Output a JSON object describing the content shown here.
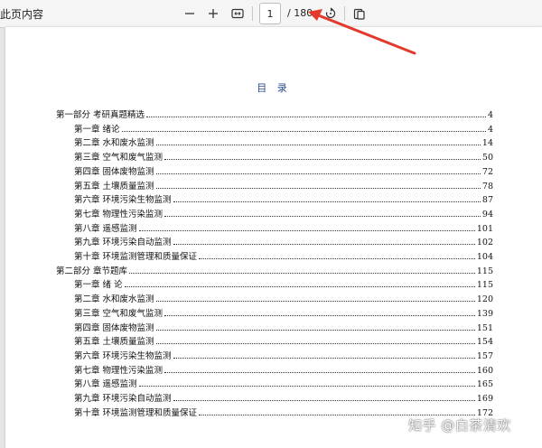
{
  "toolbar": {
    "title": "此页内容",
    "zoom_out_icon": "minus-icon",
    "zoom_in_icon": "plus-icon",
    "fit_icon": "fit-width-icon",
    "current_page": "1",
    "total_pages": "/ 180",
    "rotate_icon": "rotate-icon",
    "pages_icon": "page-view-icon"
  },
  "document": {
    "toc_title": "目 录",
    "sections": [
      {
        "label": "第一部分 考研真题精选",
        "page": "4"
      },
      {
        "label": "第一章 绪论",
        "page": "4"
      },
      {
        "label": "第二章 水和废水监测",
        "page": "14"
      },
      {
        "label": "第三章 空气和废气监测",
        "page": "50"
      },
      {
        "label": "第四章 固体废物监测",
        "page": "72"
      },
      {
        "label": "第五章 土壤质量监测",
        "page": "78"
      },
      {
        "label": "第六章 环境污染生物监测",
        "page": "87"
      },
      {
        "label": "第七章 物理性污染监测",
        "page": "94"
      },
      {
        "label": "第八章 遥感监测",
        "page": "101"
      },
      {
        "label": "第九章 环境污染自动监测",
        "page": "102"
      },
      {
        "label": "第十章 环境监测管理和质量保证",
        "page": "104"
      },
      {
        "label": "第二部分 章节题库",
        "page": "115"
      },
      {
        "label": "第一章 绪 论",
        "page": "115"
      },
      {
        "label": "第二章 水和废水监测",
        "page": "120"
      },
      {
        "label": "第三章 空气和废气监测",
        "page": "139"
      },
      {
        "label": "第四章 固体废物监测",
        "page": "151"
      },
      {
        "label": "第五章 土壤质量监测",
        "page": "154"
      },
      {
        "label": "第六章 环境污染生物监测",
        "page": "157"
      },
      {
        "label": "第七章 物理性污染监测",
        "page": "160"
      },
      {
        "label": "第八章 遥感监测",
        "page": "165"
      },
      {
        "label": "第九章 环境污染自动监测",
        "page": "169"
      },
      {
        "label": "第十章 环境监测管理和质量保证",
        "page": "172"
      }
    ]
  },
  "watermark": "知乎 @白茶清欢",
  "colors": {
    "toc_title": "#2b4a8c",
    "arrow": "#e23b2e"
  }
}
